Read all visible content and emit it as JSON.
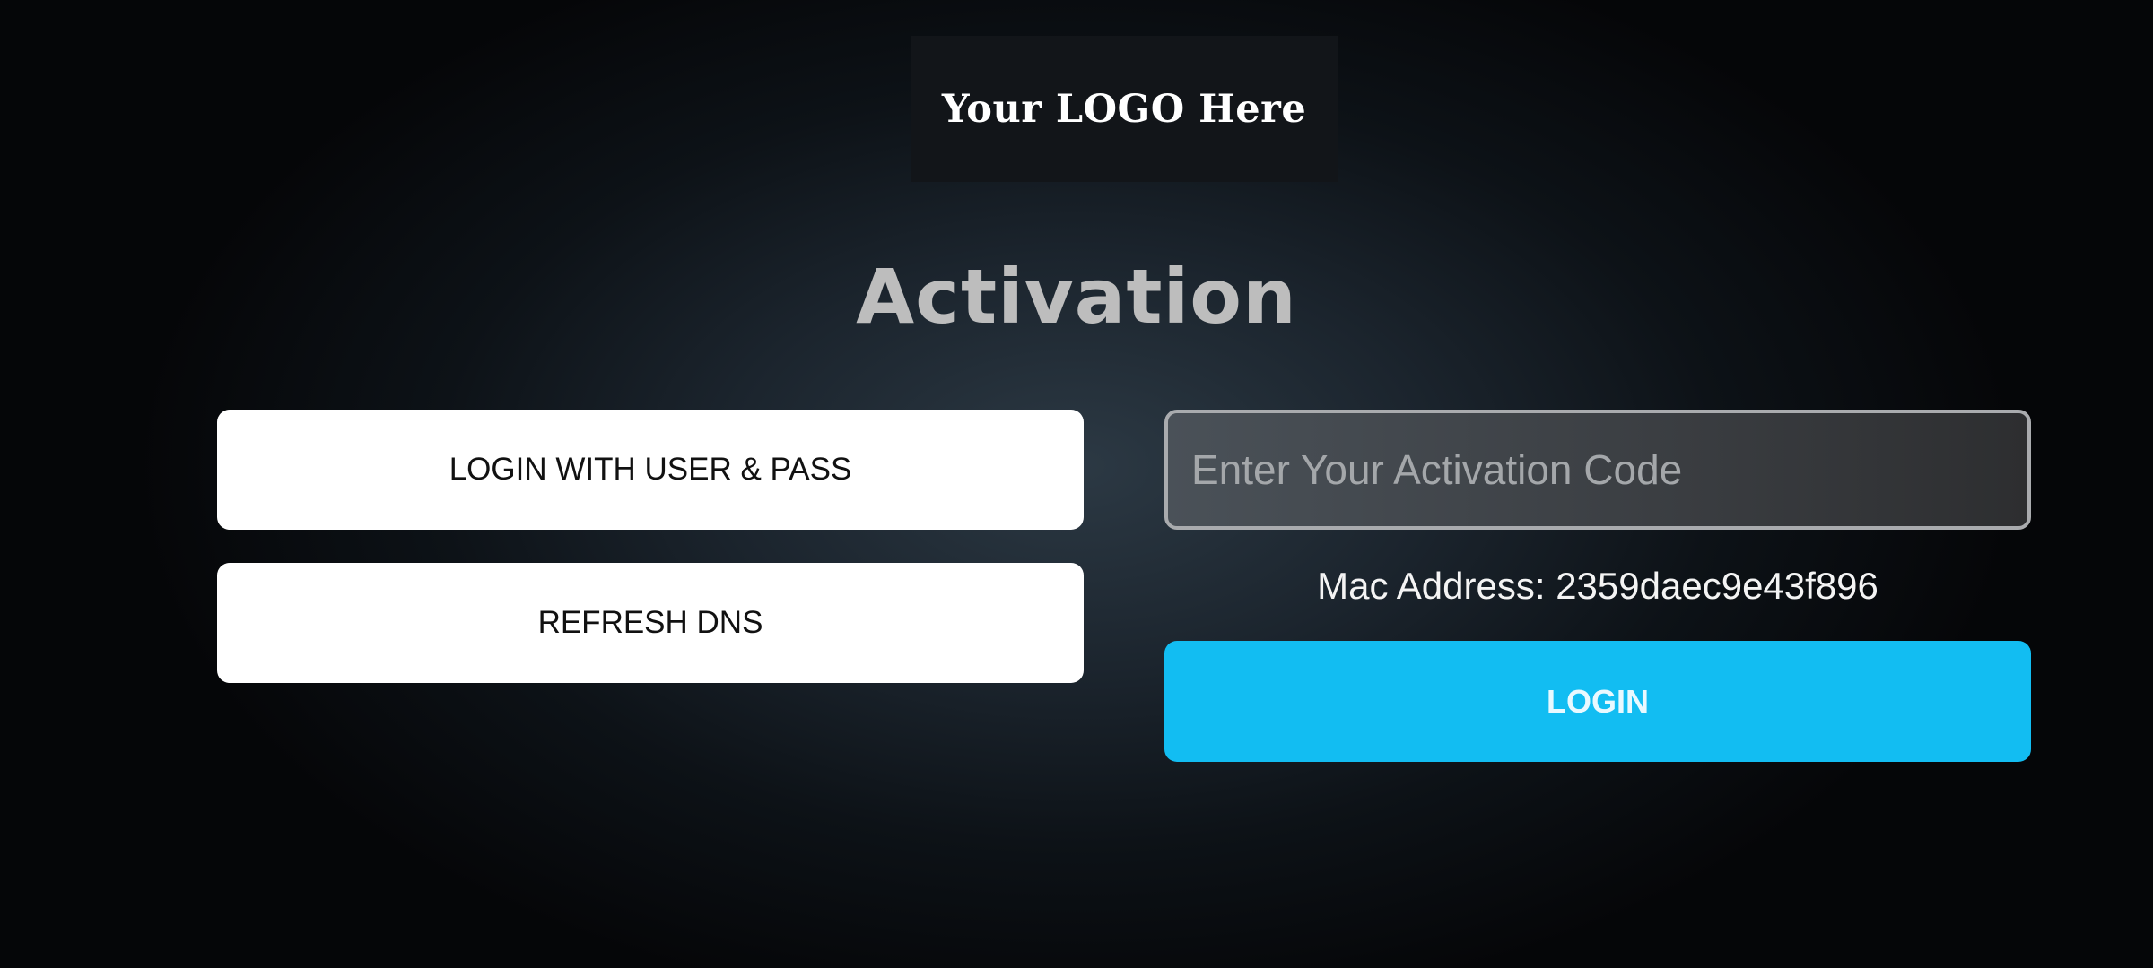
{
  "logo": {
    "text": "Your LOGO Here"
  },
  "title": "Activation",
  "left_buttons": {
    "login_user_pass": "LOGIN WITH USER & PASS",
    "refresh_dns": "REFRESH DNS"
  },
  "activation": {
    "placeholder": "Enter Your Activation Code",
    "value": "",
    "mac_address": "Mac Address: 2359daec9e43f896",
    "login_label": "LOGIN"
  },
  "colors": {
    "accent": "#12bdf2",
    "background": "#1b242d",
    "title": "#bdbdbd"
  }
}
